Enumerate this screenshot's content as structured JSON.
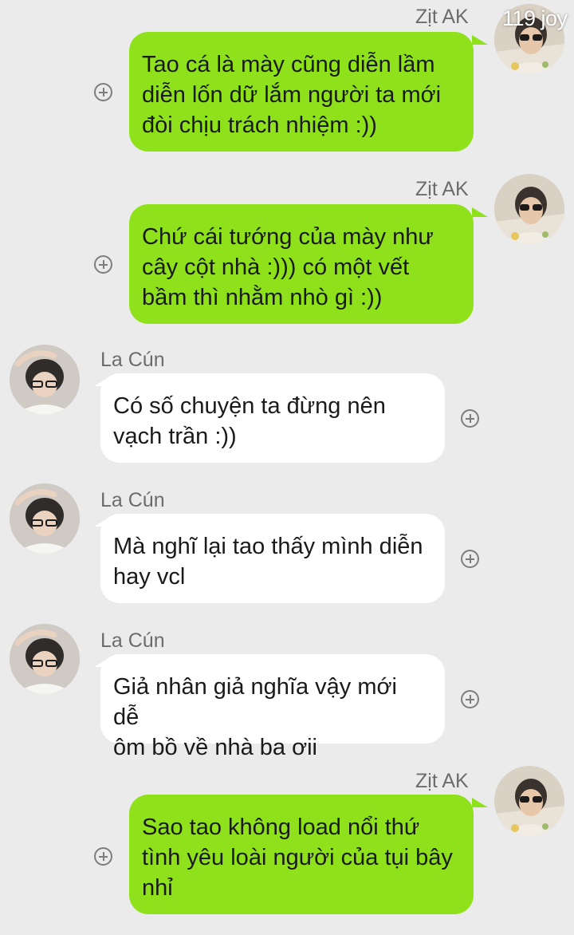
{
  "watermark": "119 joy",
  "messages": [
    {
      "sender": "Zịt AK",
      "side": "me",
      "lines": [
        "Tao cá là mày cũng diễn lầm",
        "diễn lốn dữ lắm người ta mới",
        "đòi chịu trách nhiệm :))"
      ]
    },
    {
      "sender": "Zịt AK",
      "side": "me",
      "lines": [
        "Chứ cái tướng của mày như",
        "cây cột nhà :))) có một vết",
        "bầm thì nhằm nhò gì :))"
      ]
    },
    {
      "sender": "La Cún",
      "side": "other",
      "lines": [
        "Có số chuyện ta đừng nên",
        "vạch trần :))"
      ]
    },
    {
      "sender": "La Cún",
      "side": "other",
      "lines": [
        "Mà nghĩ lại tao thấy mình diễn",
        "hay vcl"
      ]
    },
    {
      "sender": "La Cún",
      "side": "other",
      "lines": [
        "Giả nhân giả nghĩa vậy mới dễ",
        "ôm bồ về nhà ba ơii"
      ]
    },
    {
      "sender": "Zịt AK",
      "side": "me",
      "lines": [
        "Sao tao không load nổi thứ",
        "tình yêu loài người của tụi bây",
        "nhỉ"
      ]
    }
  ],
  "colors": {
    "my_bubble": "#8fe21b",
    "other_bubble": "#ffffff",
    "background": "#ebebeb"
  },
  "icons": {
    "add": "plus-circle-icon",
    "avatar": "profile-avatar"
  }
}
